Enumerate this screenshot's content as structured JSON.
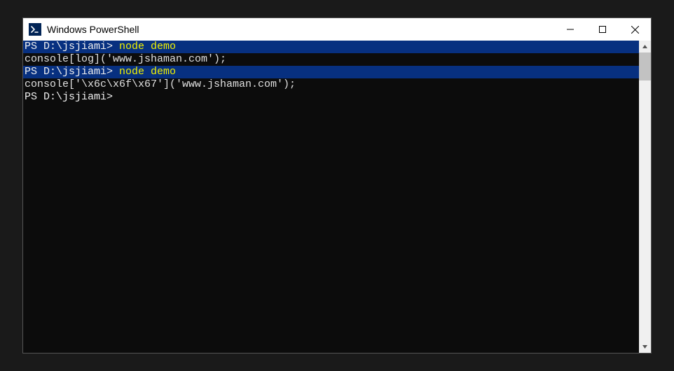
{
  "window": {
    "title": "Windows PowerShell"
  },
  "terminal": {
    "lines": [
      {
        "prompt": "PS D:\\jsjiami>",
        "command": "node demo",
        "highlighted": true
      },
      {
        "output": "console[log]('www.jshaman.com');"
      },
      {
        "prompt": "PS D:\\jsjiami>",
        "command": "node demo",
        "highlighted": true
      },
      {
        "output": "console['\\x6c\\x6f\\x67']('www.jshaman.com');"
      },
      {
        "prompt": "PS D:\\jsjiami>",
        "command": ""
      }
    ]
  },
  "colors": {
    "terminal_bg": "#0c0c0c",
    "highlight_bg": "#073080",
    "command_fg": "#f2f200",
    "text_fg": "#e0e0e0"
  }
}
